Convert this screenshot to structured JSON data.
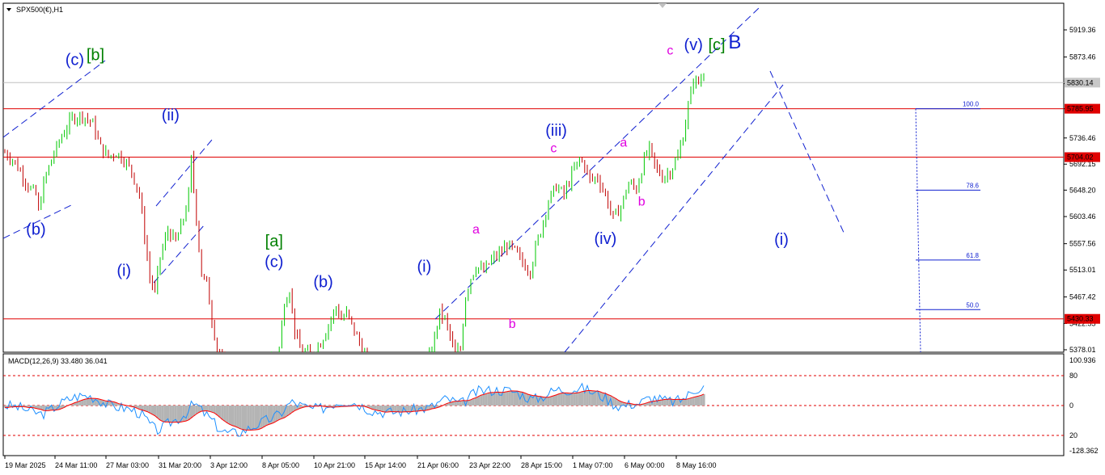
{
  "header": {
    "symbol": "SPX500(€),H1",
    "macd_label": "MACD(12,26,9) 33.480 36.041"
  },
  "colors": {
    "bull": "#00c800",
    "bear": "#c00000",
    "level": "#e00000",
    "wave_blue": "#1020d0",
    "wave_green": "#008000",
    "wave_magenta": "#e000e0",
    "macd_line": "#1e90ff",
    "signal_line": "#ff0000",
    "histogram": "#b4b4b4"
  },
  "chart_data": [
    {
      "type": "candlestick",
      "panel": "price",
      "x_ticks": [
        "19 Mar 2025",
        "24 Mar 11:00",
        "27 Mar 03:00",
        "31 Mar 20:00",
        "3 Apr 12:00",
        "8 Apr 05:00",
        "10 Apr 21:00",
        "15 Apr 14:00",
        "21 Apr 06:00",
        "23 Apr 22:00",
        "28 Apr 15:00",
        "1 May 07:00",
        "6 May 00:00",
        "8 May 16:00"
      ],
      "y_ticks": [
        5919.36,
        5873.46,
        5828.45,
        5785.95,
        5736.46,
        5692.15,
        5648.2,
        5603.46,
        5557.56,
        5513.01,
        5467.42,
        5422.55,
        5378.01
      ],
      "ylim": [
        5378.01,
        5919.36
      ],
      "current_price": 5830.14,
      "horizontal_levels": [
        5785.95,
        5704.02,
        5430.33
      ],
      "fib_levels": [
        {
          "label": "100.0",
          "value": 5785.95
        },
        {
          "label": "78.6",
          "value": 5648.2
        },
        {
          "label": "61.8",
          "value": 5530.0
        },
        {
          "label": "50.0",
          "value": 5446.0
        }
      ],
      "price_path": [
        [
          0,
          5712
        ],
        [
          3,
          5700
        ],
        [
          6,
          5680
        ],
        [
          9,
          5655
        ],
        [
          12,
          5640
        ],
        [
          13,
          5612
        ],
        [
          15,
          5660
        ],
        [
          18,
          5700
        ],
        [
          22,
          5740
        ],
        [
          26,
          5770
        ],
        [
          30,
          5775
        ],
        [
          34,
          5760
        ],
        [
          37,
          5720
        ],
        [
          40,
          5705
        ],
        [
          43,
          5712
        ],
        [
          46,
          5700
        ],
        [
          49,
          5680
        ],
        [
          52,
          5640
        ],
        [
          54,
          5570
        ],
        [
          56,
          5500
        ],
        [
          58,
          5475
        ],
        [
          60,
          5535
        ],
        [
          63,
          5580
        ],
        [
          66,
          5560
        ],
        [
          69,
          5600
        ],
        [
          71,
          5640
        ],
        [
          72,
          5700
        ],
        [
          74,
          5600
        ],
        [
          76,
          5505
        ],
        [
          78,
          5490
        ],
        [
          80,
          5430
        ],
        [
          82,
          5380
        ],
        [
          84,
          5360
        ],
        [
          88,
          5350
        ],
        [
          92,
          5350
        ],
        [
          96,
          5355
        ],
        [
          100,
          5360
        ],
        [
          104,
          5370
        ],
        [
          106,
          5380
        ],
        [
          108,
          5460
        ],
        [
          110,
          5480
        ],
        [
          112,
          5410
        ],
        [
          114,
          5380
        ],
        [
          118,
          5370
        ],
        [
          122,
          5390
        ],
        [
          126,
          5430
        ],
        [
          128,
          5450
        ],
        [
          130,
          5430
        ],
        [
          132,
          5440
        ],
        [
          134,
          5420
        ],
        [
          136,
          5400
        ],
        [
          140,
          5360
        ],
        [
          146,
          5350
        ],
        [
          152,
          5350
        ],
        [
          158,
          5355
        ],
        [
          162,
          5360
        ],
        [
          164,
          5365
        ],
        [
          166,
          5400
        ],
        [
          168,
          5440
        ],
        [
          170,
          5430
        ],
        [
          172,
          5400
        ],
        [
          174,
          5370
        ],
        [
          176,
          5380
        ],
        [
          178,
          5470
        ],
        [
          180,
          5500
        ],
        [
          182,
          5520
        ],
        [
          185,
          5510
        ],
        [
          188,
          5530
        ],
        [
          191,
          5540
        ],
        [
          194,
          5555
        ],
        [
          197,
          5545
        ],
        [
          200,
          5525
        ],
        [
          203,
          5512
        ],
        [
          205,
          5550
        ],
        [
          207,
          5580
        ],
        [
          210,
          5630
        ],
        [
          213,
          5655
        ],
        [
          216,
          5640
        ],
        [
          219,
          5675
        ],
        [
          222,
          5700
        ],
        [
          224,
          5690
        ],
        [
          226,
          5665
        ],
        [
          229,
          5670
        ],
        [
          232,
          5640
        ],
        [
          235,
          5600
        ],
        [
          238,
          5620
        ],
        [
          241,
          5660
        ],
        [
          244,
          5650
        ],
        [
          247,
          5700
        ],
        [
          249,
          5718
        ],
        [
          251,
          5690
        ],
        [
          254,
          5670
        ],
        [
          257,
          5680
        ],
        [
          260,
          5705
        ],
        [
          262,
          5740
        ],
        [
          264,
          5790
        ],
        [
          266,
          5835
        ],
        [
          268,
          5830
        ],
        [
          270,
          5845
        ]
      ],
      "x_count": 270,
      "wave_labels": [
        {
          "text": "(c)",
          "color": "blue",
          "value": 5860,
          "x_idx": 27
        },
        {
          "text": "[b]",
          "color": "green",
          "value": 5868,
          "x_idx": 35
        },
        {
          "text": "(b)",
          "color": "blue",
          "value": 5573,
          "x_idx": 12
        },
        {
          "text": "(ii)",
          "color": "blue",
          "value": 5766,
          "x_idx": 64
        },
        {
          "text": "(i)",
          "color": "blue",
          "value": 5503,
          "x_idx": 46
        },
        {
          "text": "[a]",
          "color": "green",
          "value": 5553,
          "x_idx": 104
        },
        {
          "text": "(c)",
          "color": "blue",
          "value": 5518,
          "x_idx": 104
        },
        {
          "text": "(b)",
          "color": "blue",
          "value": 5484,
          "x_idx": 123
        },
        {
          "text": "(i)",
          "color": "blue",
          "value": 5510,
          "x_idx": 162
        },
        {
          "text": "a",
          "color": "magenta",
          "value": 5575,
          "x_idx": 182
        },
        {
          "text": "b",
          "color": "magenta",
          "value": 5415,
          "x_idx": 196
        },
        {
          "text": "(iii)",
          "color": "blue",
          "value": 5740,
          "x_idx": 213
        },
        {
          "text": "c",
          "color": "magenta",
          "value": 5712,
          "x_idx": 212
        },
        {
          "text": "(iv)",
          "color": "blue",
          "value": 5557,
          "x_idx": 232
        },
        {
          "text": "a",
          "color": "magenta",
          "value": 5722,
          "x_idx": 239
        },
        {
          "text": "b",
          "color": "magenta",
          "value": 5622,
          "x_idx": 246
        },
        {
          "text": "c",
          "color": "magenta",
          "value": 5878,
          "x_idx": 257
        },
        {
          "text": "(v)",
          "color": "blue",
          "value": 5885,
          "x_idx": 266
        },
        {
          "text": "[c]",
          "color": "green",
          "value": 5885,
          "x_idx": 275
        },
        {
          "text": "B",
          "color": "blue",
          "value": 5888,
          "x_idx": 282
        },
        {
          "text": "(i)",
          "color": "blue",
          "value": 5556,
          "x_idx": 300
        }
      ]
    },
    {
      "type": "macd",
      "panel": "indicator",
      "y_ticks": [
        100.936,
        80,
        0,
        20,
        -128.362
      ],
      "levels": [
        80,
        0,
        -80
      ]
    }
  ]
}
